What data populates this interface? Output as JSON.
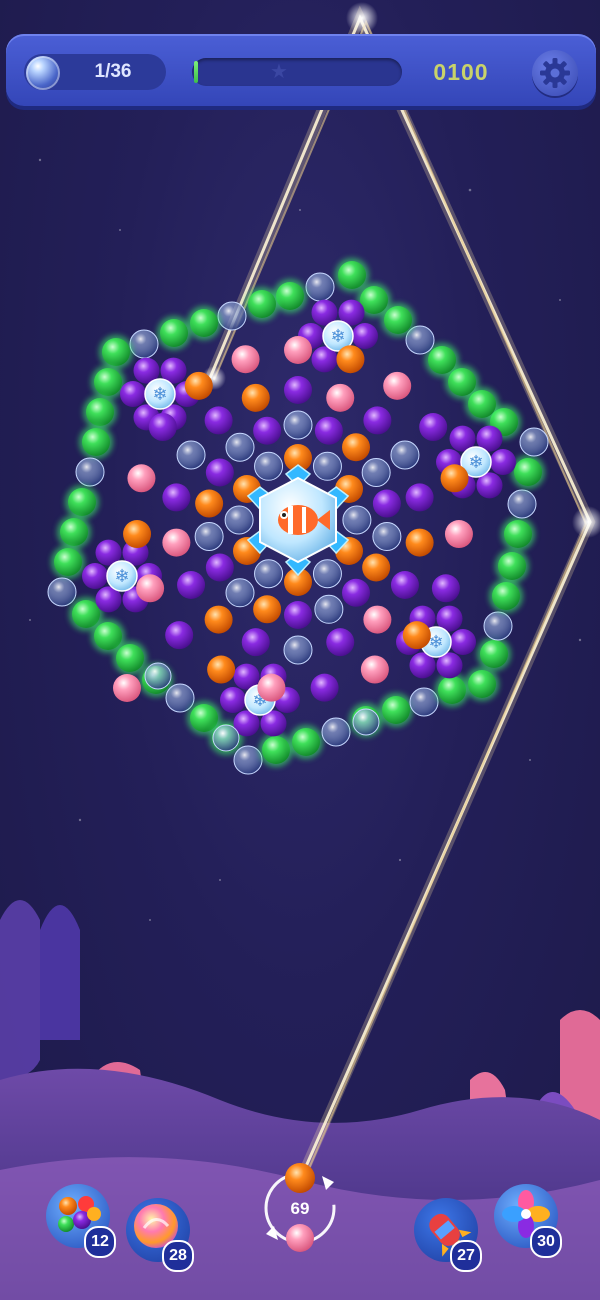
{
  "hud": {
    "moves_label": "1/36",
    "score": "0100",
    "progress_fraction": 0.02
  },
  "shooter": {
    "shots_left": "69",
    "current_bubble": "orange",
    "next_bubble": "pink"
  },
  "boosters": [
    {
      "name": "color-bubbles-booster",
      "count": "12"
    },
    {
      "name": "rainbow-bubble-booster",
      "count": "28"
    },
    {
      "name": "rocket-booster",
      "count": "27"
    },
    {
      "name": "pinwheel-booster",
      "count": "30"
    }
  ],
  "center_target": "clownfish-in-ice",
  "colors": {
    "green": "#3fe05a",
    "orange": "#ff8a1c",
    "purple": "#8a2be2",
    "pink": "#ff8fb0",
    "clear": "#9fb7e6",
    "gem": "#33b8ff",
    "topbar": "#4153c8",
    "background": "#231f58"
  }
}
